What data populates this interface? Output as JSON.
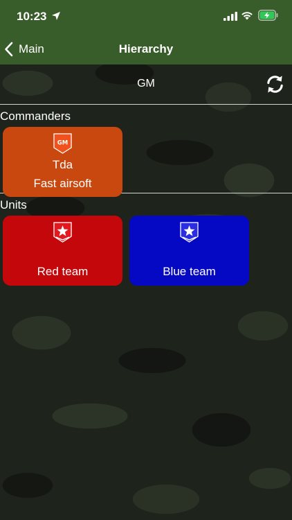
{
  "status_bar": {
    "time": "10:23"
  },
  "nav": {
    "back_label": "Main",
    "title": "Hierarchy"
  },
  "role_label": "GM",
  "sections": {
    "commanders": {
      "title": "Commanders",
      "items": [
        {
          "badge": "GM",
          "name": "Tda",
          "team": "Fast airsoft",
          "color": "#c9480f"
        }
      ]
    },
    "units": {
      "title": "Units",
      "items": [
        {
          "name": "Red team",
          "color": "#c3070b"
        },
        {
          "name": "Blue team",
          "color": "#0609c3"
        }
      ]
    }
  },
  "colors": {
    "header": "#395d2a",
    "commander_card": "#c9480f",
    "red_unit": "#c3070b",
    "blue_unit": "#0609c3"
  },
  "icons": {
    "back": "chevron-left-icon",
    "refresh": "refresh-icon",
    "commander_badge": "gm-shield-icon",
    "unit_badge": "star-shield-icon"
  }
}
